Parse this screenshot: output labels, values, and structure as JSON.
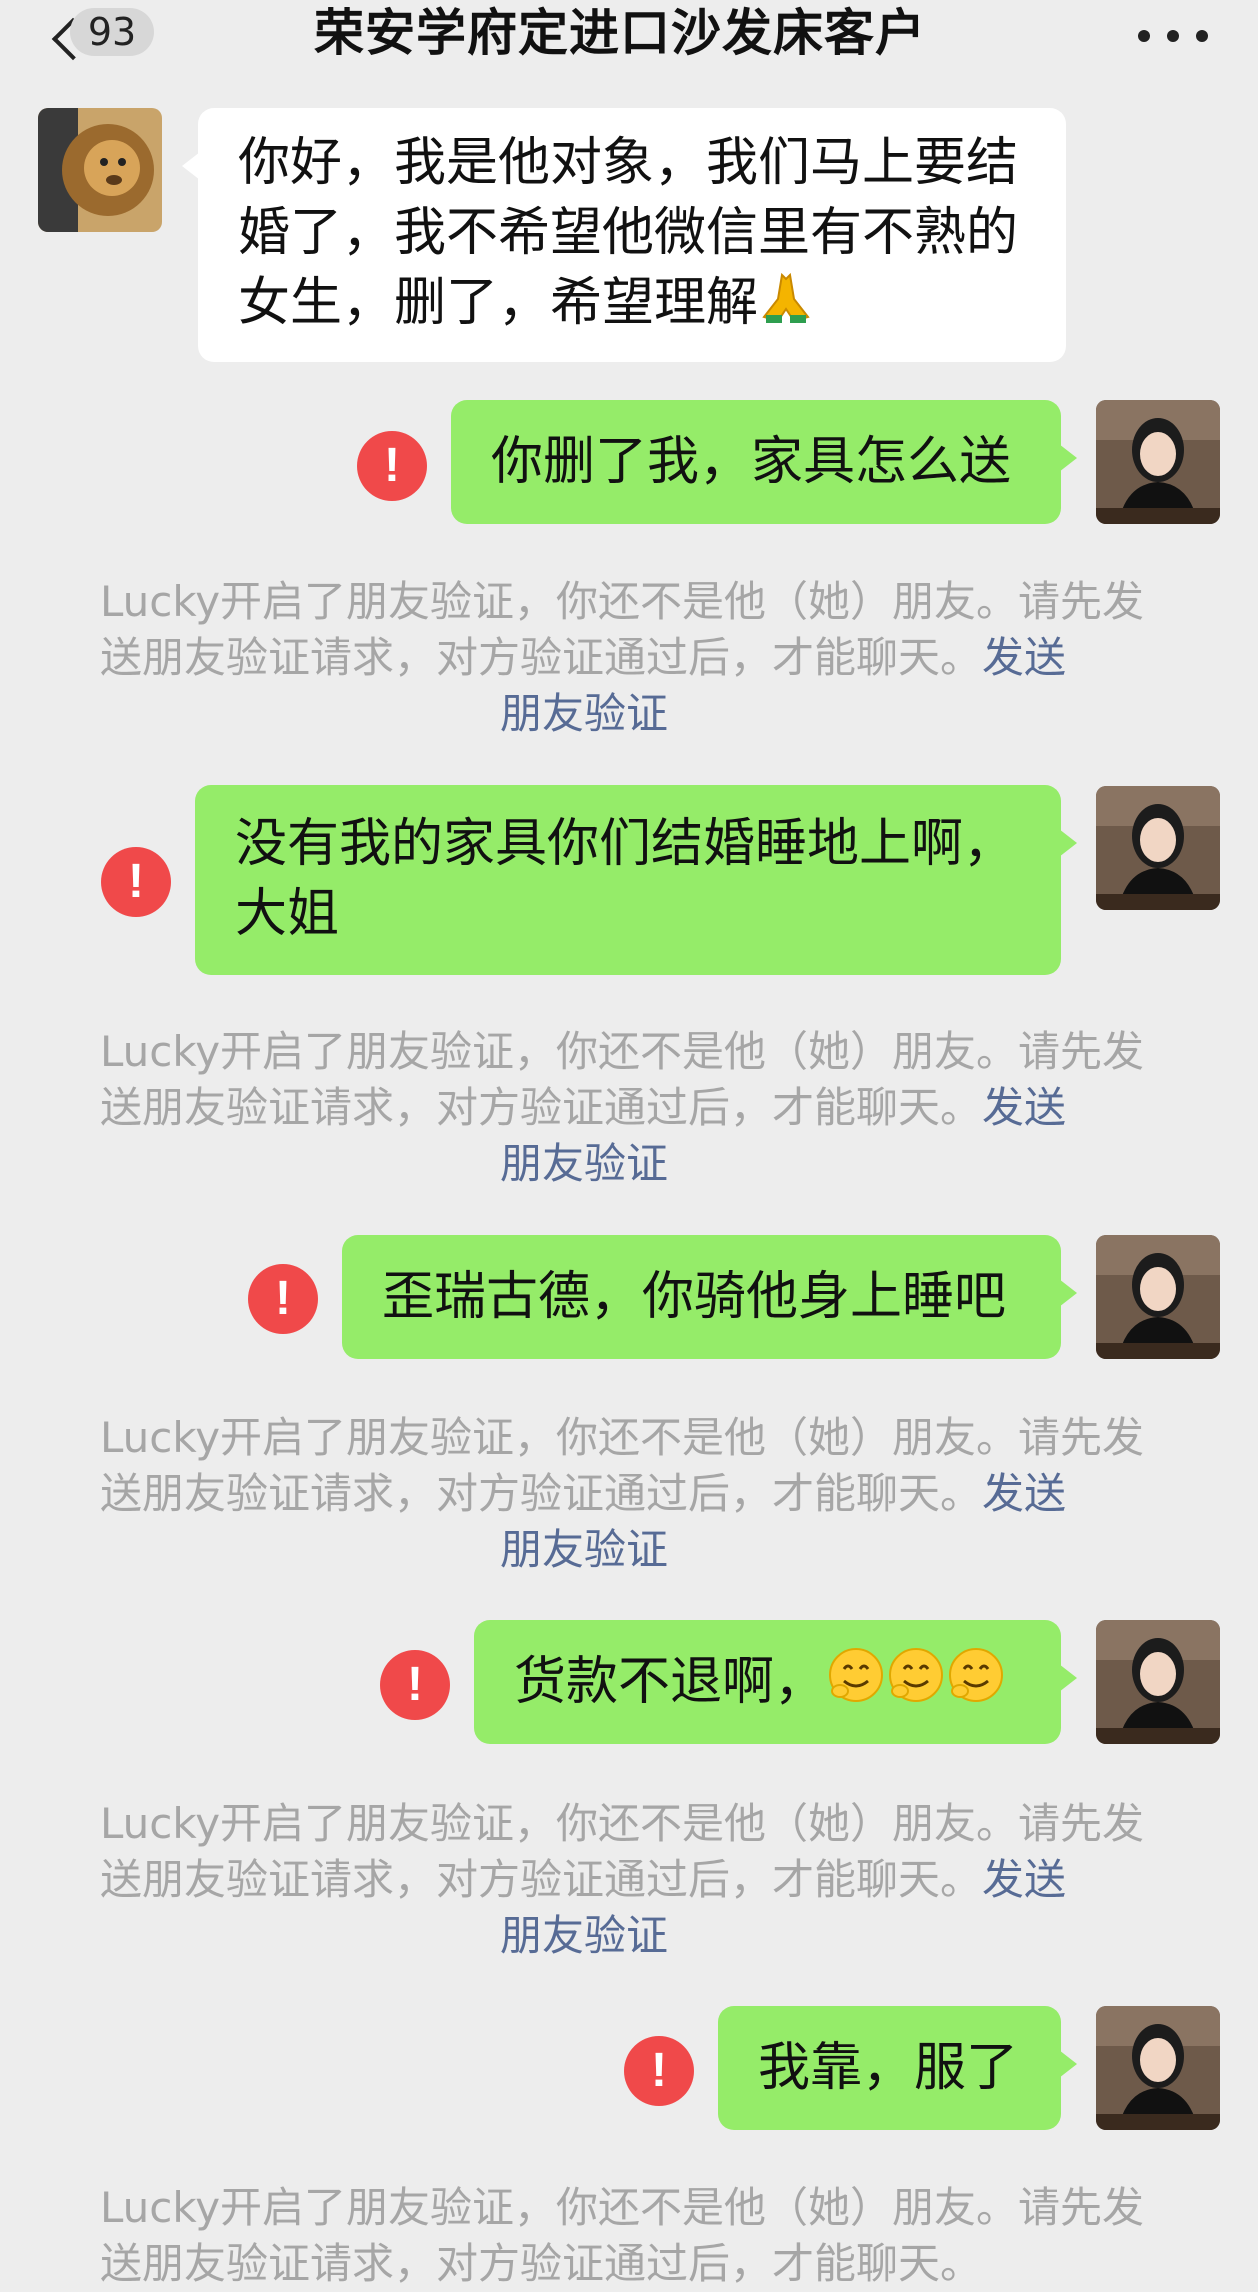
{
  "header": {
    "unread_count": "93",
    "title": "荣安学府定进口沙发床客户"
  },
  "incoming": {
    "text": "你好，我是他对象，我们马上要结婚了，我不希望他微信里有不熟的女生，删了，希望理解",
    "emoji": "pray-emoji"
  },
  "messages": [
    {
      "text": "你删了我，家具怎么送",
      "status": "send-failed"
    },
    {
      "text": "没有我的家具你们结婚睡地上啊，大姐",
      "status": "send-failed"
    },
    {
      "text": "歪瑞古德，你骑他身上睡吧",
      "status": "send-failed"
    },
    {
      "text": "货款不退啊，",
      "status": "send-failed",
      "emoji": "smile-emoji x3"
    },
    {
      "text": "我靠，服了",
      "status": "send-failed"
    }
  ],
  "system_note": {
    "text": "Lucky开启了朋友验证，你还不是他（她）朋友。请先发送朋友验证请求，对方验证通过后，才能聊天。",
    "link_part1": "发送",
    "link_part2": "朋友验证"
  },
  "colors": {
    "background": "#ededed",
    "outgoing_bubble": "#95ec69",
    "incoming_bubble": "#ffffff",
    "fail_icon": "#f0494a",
    "system_text": "#a6a6a6",
    "link": "#576b95"
  }
}
